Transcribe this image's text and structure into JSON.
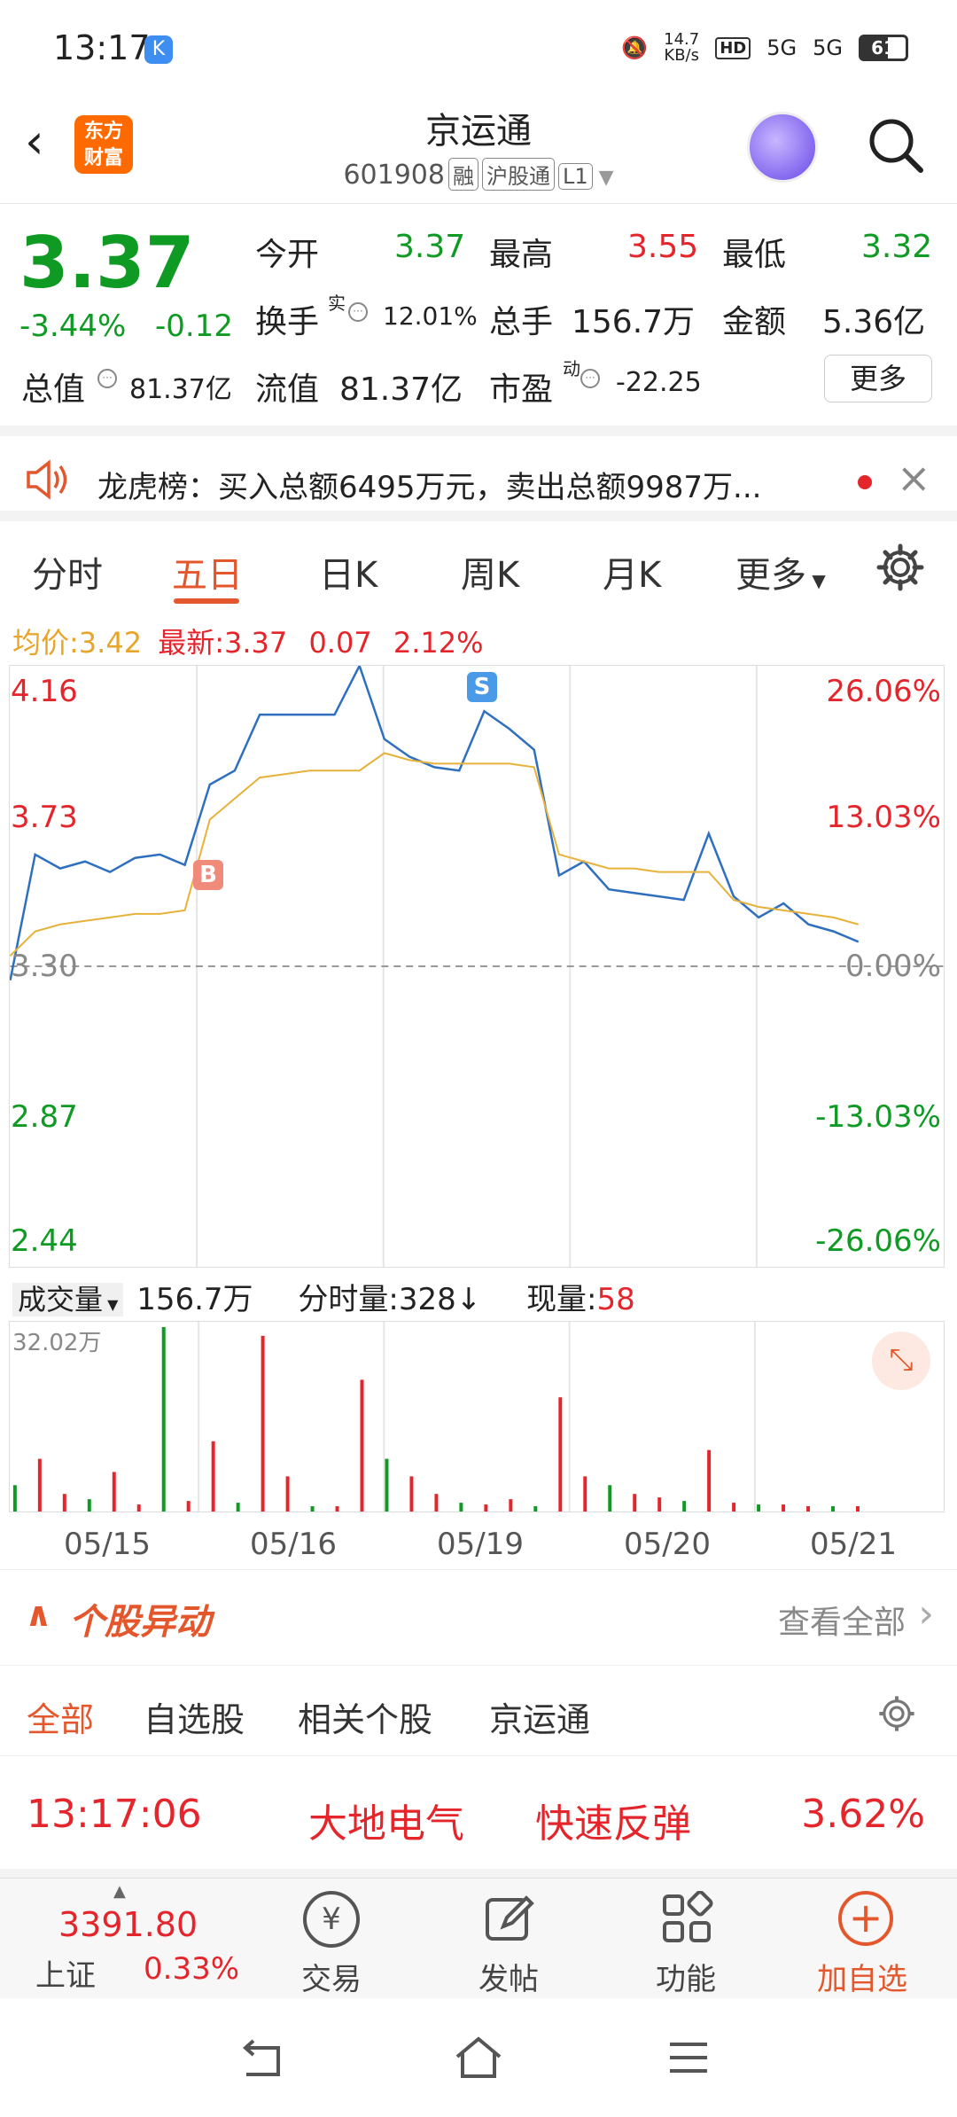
{
  "status": {
    "time": "13:17",
    "speed_top": "14.7",
    "speed_unit": "KB/s",
    "net1": "5G",
    "net2": "5G",
    "battery": "61",
    "hd": "HD"
  },
  "header": {
    "title": "京运通",
    "code": "601908",
    "tags": [
      "融",
      "沪股通",
      "L1"
    ],
    "logo_line1": "东方",
    "logo_line2": "财富"
  },
  "quote": {
    "price": "3.37",
    "change_pct": "-3.44%",
    "change_val": "-0.12",
    "open_label": "今开",
    "open": "3.37",
    "high_label": "最高",
    "high": "3.55",
    "low_label": "最低",
    "low": "3.32",
    "turnover_label": "换手",
    "turnover_sup": "实",
    "turnover": "12.01%",
    "volume_label": "总手",
    "volume": "156.7万",
    "amount_label": "金额",
    "amount": "5.36亿",
    "mktcap_label": "总值",
    "mktcap": "81.37亿",
    "float_label": "流值",
    "float": "81.37亿",
    "pe_label": "市盈",
    "pe_sup": "动",
    "pe": "-22.25",
    "more": "更多"
  },
  "banner": {
    "text": "龙虎榜：买入总额6495万元，卖出总额9987万..."
  },
  "tabs": [
    "分时",
    "五日",
    "日K",
    "周K",
    "月K",
    "更多"
  ],
  "avg": {
    "avg_label": "均价:",
    "avg": "3.42",
    "latest_label": "最新:",
    "latest": "3.37",
    "chg": "0.07",
    "pct": "2.12%"
  },
  "chart": {
    "y_left": [
      "4.16",
      "3.73",
      "3.30",
      "2.87",
      "2.44"
    ],
    "y_right": [
      "26.06%",
      "13.03%",
      "0.00%",
      "-13.03%",
      "-26.06%"
    ],
    "buy_mark": "B",
    "sell_mark": "S",
    "dates": [
      "05/15",
      "05/16",
      "05/19",
      "05/20",
      "05/21"
    ]
  },
  "volume": {
    "label": "成交量",
    "total": "156.7万",
    "tick_label": "分时量:",
    "tick": "328",
    "tick_arrow": "↓",
    "now_label": "现量:",
    "now": "58",
    "max": "32.02万"
  },
  "section": {
    "title": "个股异动",
    "view_all": "查看全部"
  },
  "subtabs": [
    "全部",
    "自选股",
    "相关个股",
    "京运通"
  ],
  "event": {
    "time": "13:17:06",
    "stock": "大地电气",
    "type": "快速反弹",
    "pct": "3.62%"
  },
  "bottom": {
    "index_value": "3391.80",
    "index_name": "上证",
    "index_pct": "0.33%",
    "trade": "交易",
    "post": "发帖",
    "func": "功能",
    "add": "加自选"
  },
  "chart_data": {
    "type": "line",
    "title": "",
    "x_categories": [
      "05/15",
      "05/16",
      "05/19",
      "05/20",
      "05/21"
    ],
    "ylim": [
      2.44,
      4.16
    ],
    "series": [
      {
        "name": "",
        "values": [
          3.26,
          3.62,
          3.58,
          3.6,
          3.57,
          3.61,
          3.62,
          3.59,
          3.82,
          3.86,
          4.02,
          4.02,
          4.02,
          4.02,
          4.16,
          3.95,
          3.9,
          3.87,
          3.86,
          4.03,
          3.98,
          3.92,
          3.56,
          3.6,
          3.52,
          3.51,
          3.5,
          3.49,
          3.68,
          3.5,
          3.44,
          3.48,
          3.42,
          3.4,
          3.37
        ]
      },
      {
        "name": "",
        "values": [
          3.33,
          3.4,
          3.42,
          3.43,
          3.44,
          3.45,
          3.45,
          3.46,
          3.72,
          3.78,
          3.84,
          3.85,
          3.86,
          3.86,
          3.86,
          3.91,
          3.89,
          3.88,
          3.88,
          3.88,
          3.88,
          3.87,
          3.62,
          3.6,
          3.58,
          3.58,
          3.57,
          3.57,
          3.57,
          3.49,
          3.47,
          3.46,
          3.45,
          3.44,
          3.42
        ]
      }
    ],
    "reference": 3.3
  }
}
